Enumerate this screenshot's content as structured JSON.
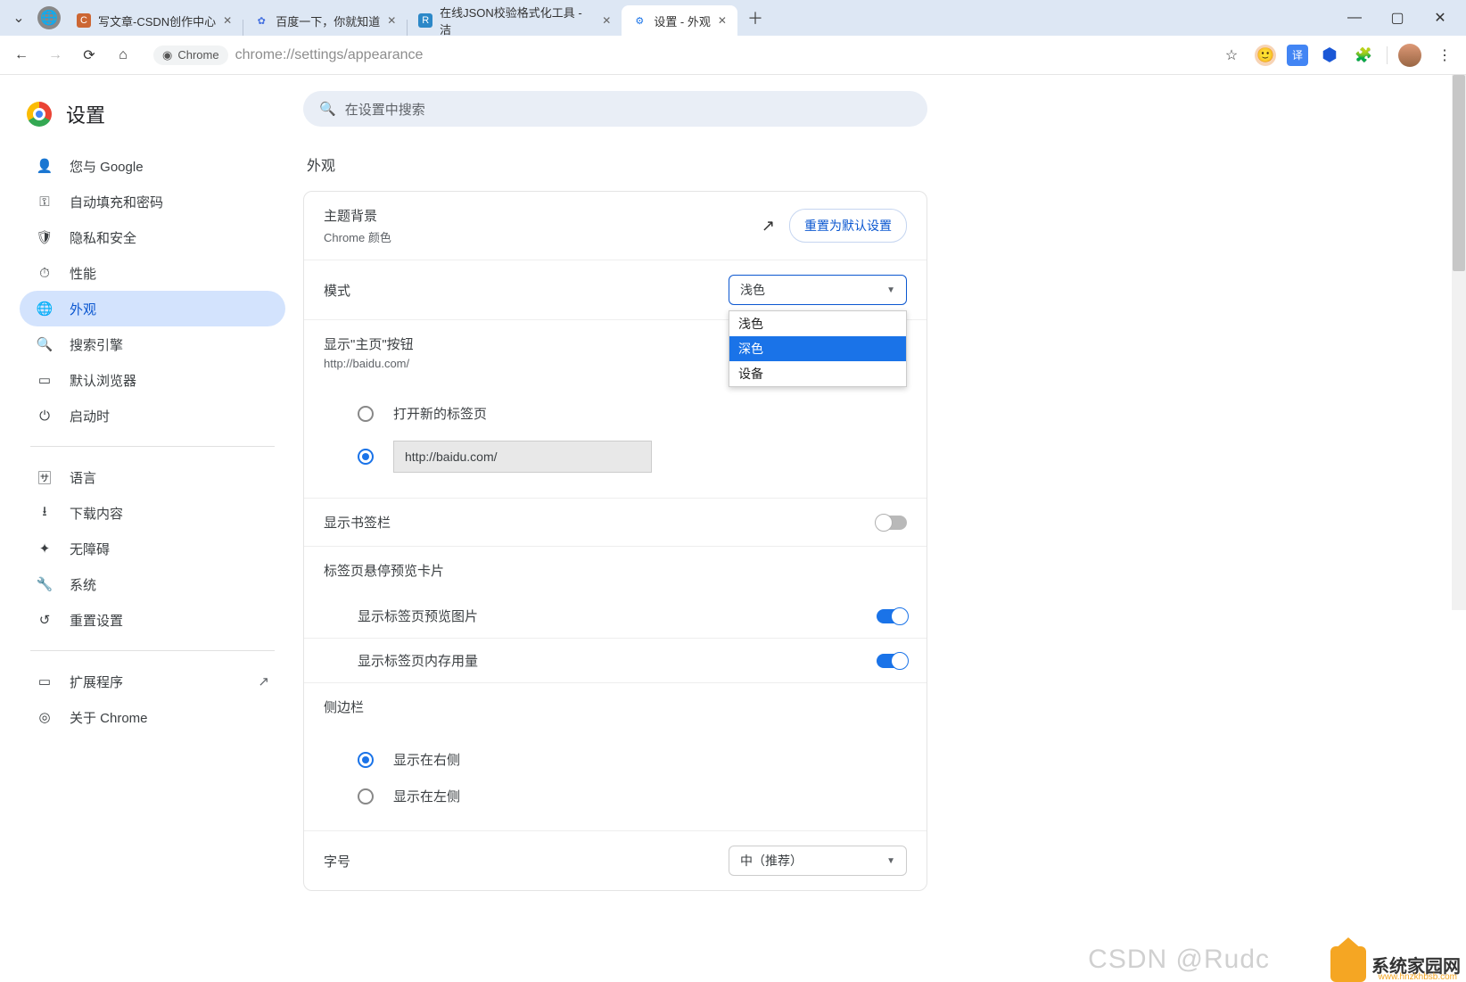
{
  "window": {
    "tabs": [
      {
        "title": "写文章-CSDN创作中心",
        "favBg": "#c63",
        "favText": "C"
      },
      {
        "title": "百度一下，你就知道",
        "favBg": "#4470e0",
        "favText": "✿"
      },
      {
        "title": "在线JSON校验格式化工具 - 洁",
        "favBg": "#2c88c8",
        "favText": "R"
      },
      {
        "title": "设置 - 外观",
        "favBg": "#1a73e8",
        "favText": "⚙",
        "active": true
      }
    ]
  },
  "addr": {
    "chipLabel": "Chrome",
    "url": "chrome://settings/appearance"
  },
  "settings": {
    "title": "设置",
    "searchPlaceholder": "在设置中搜索",
    "nav": [
      {
        "icon": "👤",
        "label": "您与 Google"
      },
      {
        "icon": "⚿",
        "label": "自动填充和密码"
      },
      {
        "icon": "🛡",
        "label": "隐私和安全"
      },
      {
        "icon": "⏱",
        "label": "性能"
      },
      {
        "icon": "🌐",
        "label": "外观",
        "active": true
      },
      {
        "icon": "🔍",
        "label": "搜索引擎"
      },
      {
        "icon": "▭",
        "label": "默认浏览器"
      },
      {
        "icon": "⏻",
        "label": "启动时"
      }
    ],
    "nav2": [
      {
        "icon": "🈂",
        "label": "语言"
      },
      {
        "icon": "⭳",
        "label": "下载内容"
      },
      {
        "icon": "✦",
        "label": "无障碍"
      },
      {
        "icon": "🔧",
        "label": "系统"
      },
      {
        "icon": "↺",
        "label": "重置设置"
      }
    ],
    "nav3": [
      {
        "icon": "▭",
        "label": "扩展程序",
        "ext": true
      },
      {
        "icon": "◎",
        "label": "关于 Chrome"
      }
    ],
    "section": "外观",
    "theme": {
      "label": "主题背景",
      "sub": "Chrome 颜色",
      "reset": "重置为默认设置"
    },
    "mode": {
      "label": "模式",
      "selected": "浅色",
      "options": [
        "浅色",
        "深色",
        "设备"
      ],
      "highlighted": "深色"
    },
    "homebtn": {
      "label": "显示\"主页\"按钮",
      "sub": "http://baidu.com/"
    },
    "homepage": {
      "opt1": "打开新的标签页",
      "opt2value": "http://baidu.com/"
    },
    "bookmarks": {
      "label": "显示书签栏"
    },
    "hover": {
      "label": "标签页悬停预览卡片"
    },
    "hoverImg": {
      "label": "显示标签页预览图片"
    },
    "hoverMem": {
      "label": "显示标签页内存用量"
    },
    "sidepanel": {
      "label": "侧边栏",
      "opt1": "显示在右侧",
      "opt2": "显示在左侧"
    },
    "fontsize": {
      "label": "字号",
      "value": "中（推荐）"
    }
  },
  "watermark": {
    "csdn": "CSDN @Rudc",
    "brand": "系统家园网",
    "brandSub": "www.hnzkhbsb.com"
  }
}
